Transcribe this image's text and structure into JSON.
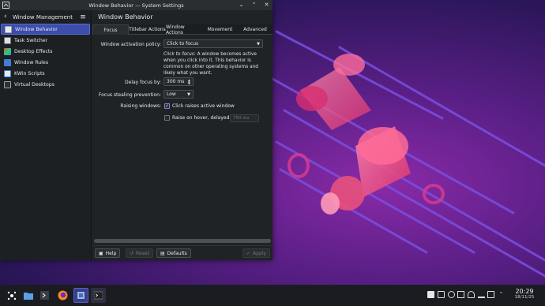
{
  "window": {
    "title": "Window Behavior — System Settings"
  },
  "sidebar": {
    "title": "Window Management",
    "items": [
      {
        "label": "Window Behavior",
        "icon": "window-behavior-icon",
        "active": true
      },
      {
        "label": "Task Switcher",
        "icon": "task-switcher-icon"
      },
      {
        "label": "Desktop Effects",
        "icon": "desktop-effects-icon"
      },
      {
        "label": "Window Rules",
        "icon": "window-rules-icon"
      },
      {
        "label": "KWin Scripts",
        "icon": "kwin-scripts-icon"
      },
      {
        "label": "Virtual Desktops",
        "icon": "virtual-desktops-icon"
      }
    ]
  },
  "page": {
    "title": "Window Behavior",
    "tabs": [
      {
        "label": "Focus",
        "active": true
      },
      {
        "label": "Titlebar Actions"
      },
      {
        "label": "Window Actions"
      },
      {
        "label": "Movement"
      },
      {
        "label": "Advanced"
      }
    ]
  },
  "focus": {
    "activation_policy_label": "Window activation policy:",
    "activation_policy_value": "Click to focus",
    "description_em": "Click to focus:",
    "description_text": " A window becomes active when you click into it. This behavior is common on other operating systems and likely what you want.",
    "delay_label": "Delay focus by:",
    "delay_value": "300 ms",
    "stealing_label": "Focus stealing prevention:",
    "stealing_value": "Low",
    "raising_label": "Raising windows:",
    "click_raises_label": "Click raises active window",
    "click_raises_checked": true,
    "raise_hover_label": "Raise on hover, delayed by:",
    "raise_hover_checked": false,
    "raise_hover_value": "750 ms"
  },
  "footer": {
    "help": "Help",
    "reset": "Reset",
    "defaults": "Defaults",
    "apply": "Apply"
  },
  "taskbar": {
    "time": "20:29",
    "date": "18/11/25"
  },
  "colors": {
    "accent": "#3d4dac",
    "window_bg": "#202326",
    "taskbar_bg": "#1b1c22"
  }
}
